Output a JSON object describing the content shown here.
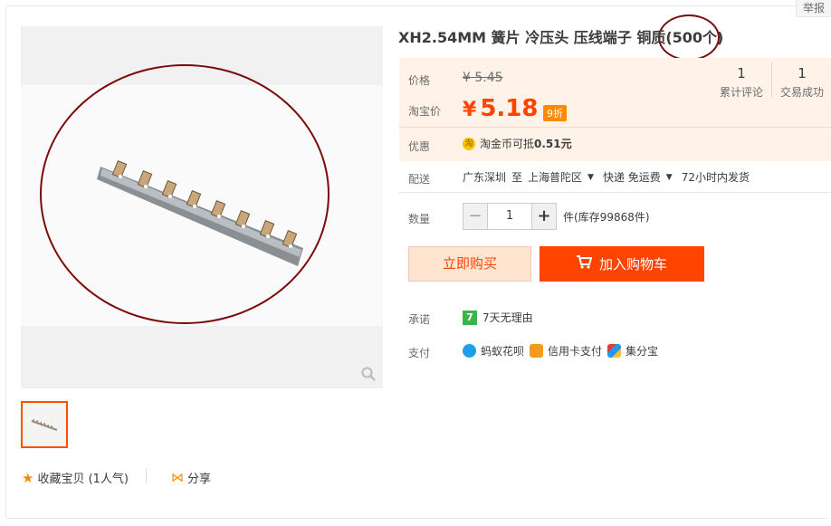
{
  "report_label": "举报",
  "title": "XH2.54MM 簧片 冷压头 压线端子 铜质(500个)",
  "price": {
    "label": "价格",
    "original": "¥ 5.45",
    "promo_label": "淘宝价",
    "currency": "¥",
    "current": "5.18",
    "discount_badge": "9折"
  },
  "stats": [
    {
      "count": "1",
      "label": "累计评论"
    },
    {
      "count": "1",
      "label": "交易成功"
    }
  ],
  "coupon": {
    "label": "优惠",
    "icon_glyph": "淘",
    "text_prefix": "淘金币可抵",
    "amount": "0.51元"
  },
  "shipping": {
    "label": "配送",
    "from": "广东深圳",
    "to_word": "至",
    "destination": "上海普陀区",
    "method": "快递 免运费",
    "dispatch": "72小时内发货"
  },
  "quantity": {
    "label": "数量",
    "minus": "−",
    "value": "1",
    "plus": "+",
    "stock_text": "件(库存99868件)"
  },
  "buttons": {
    "buy_now": "立即购买",
    "add_to_cart": "加入购物车"
  },
  "promise": {
    "label": "承诺",
    "badge": "7",
    "text": "7天无理由"
  },
  "payment": {
    "label": "支付",
    "methods": [
      "蚂蚁花呗",
      "信用卡支付",
      "集分宝"
    ]
  },
  "favorite": {
    "text": "收藏宝贝 (1人气)"
  },
  "share": {
    "text": "分享"
  },
  "colors": {
    "accent": "#ff4400",
    "panel_bg": "#fff2e8",
    "annotation_circle": "#7b0a0a"
  }
}
